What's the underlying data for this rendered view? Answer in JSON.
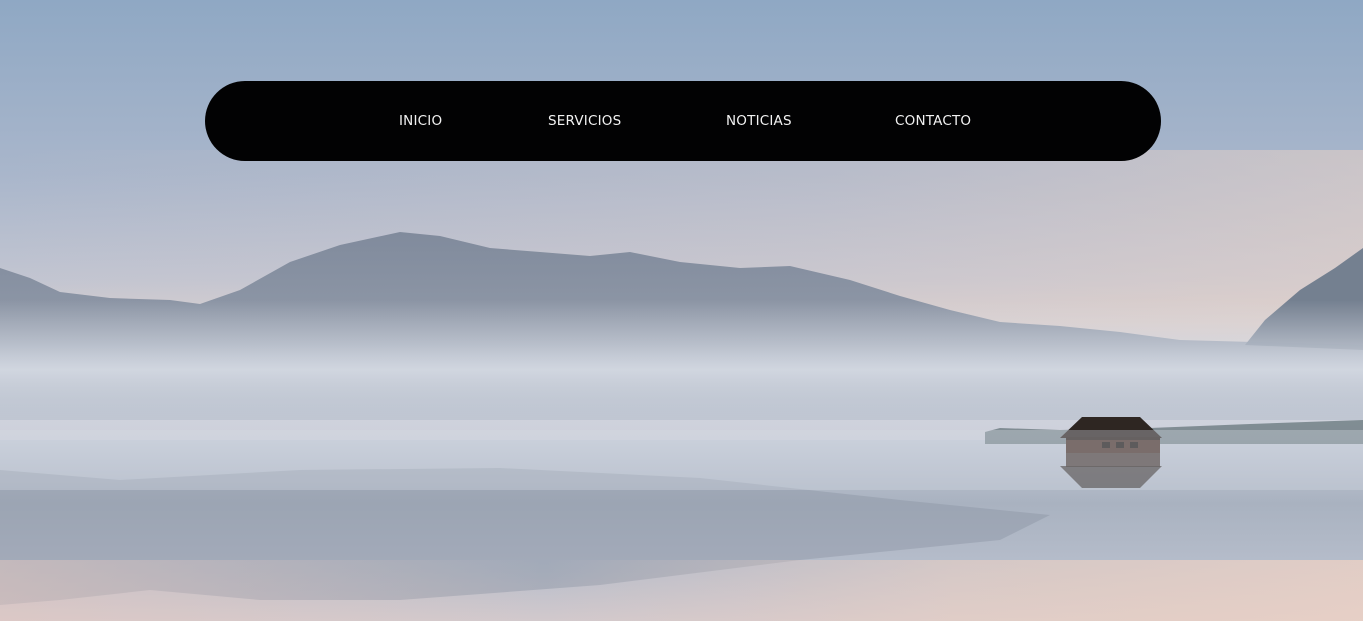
{
  "background": {
    "image": "misty-lake-with-boathouse",
    "colors": {
      "sky_top": "#93acc6",
      "sky_mid": "#b9c1d3",
      "horizon_warm": "#dccfcb",
      "mountain": "#7a8596",
      "fog": "#c9cfdb",
      "water": "#a7b0bf",
      "boathouse": "#3a2c26"
    }
  },
  "nav": {
    "background": "#020203",
    "text_color": "#f2f2f2",
    "items": [
      {
        "label": "INICIO"
      },
      {
        "label": "SERVICIOS"
      },
      {
        "label": "NOTICIAS"
      },
      {
        "label": "CONTACTO"
      }
    ]
  }
}
